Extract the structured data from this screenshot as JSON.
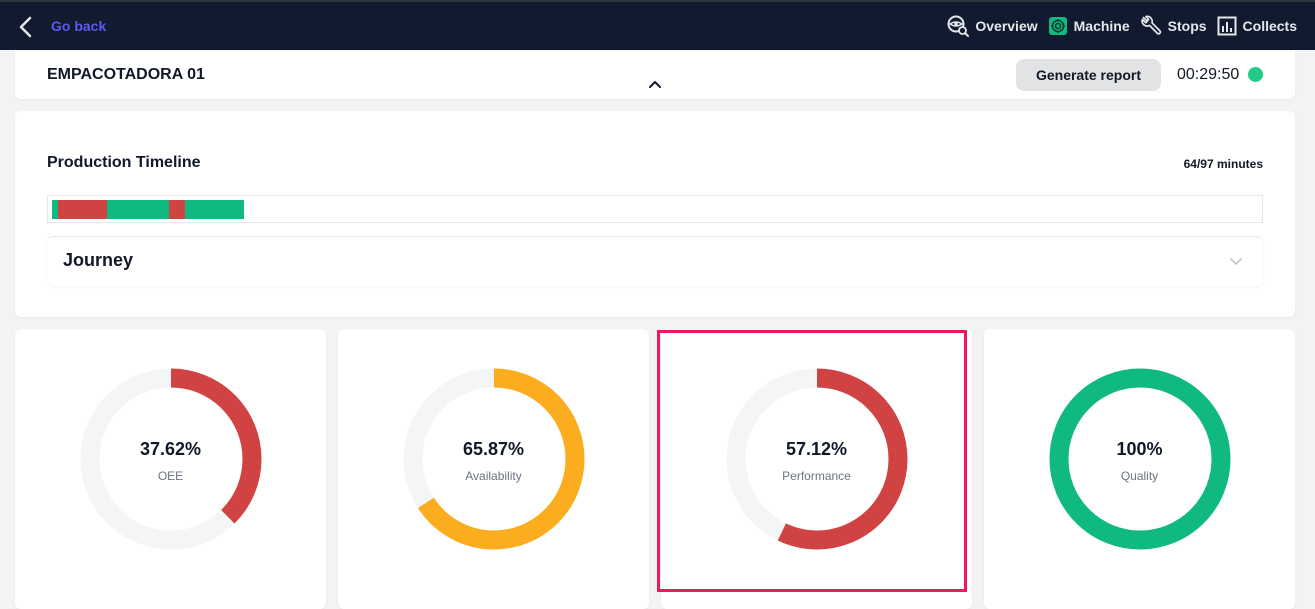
{
  "nav": {
    "back_label": "Go back",
    "items": [
      {
        "label": "Overview",
        "icon": "overview-search-icon"
      },
      {
        "label": "Machine",
        "icon": "machine-icon"
      },
      {
        "label": "Stops",
        "icon": "wrench-icon"
      },
      {
        "label": "Collects",
        "icon": "bar-chart-icon"
      }
    ]
  },
  "header": {
    "machine_name": "EMPACOTADORA 01",
    "report_button": "Generate report",
    "timer": "00:29:50",
    "status_color": "#22cc88"
  },
  "timeline": {
    "title": "Production Timeline",
    "minutes": "64/97 minutes",
    "segments": [
      {
        "status": "running",
        "color": "#10b981",
        "minutes": 0.5
      },
      {
        "status": "stopped",
        "color": "#d14343",
        "minutes": 4
      },
      {
        "status": "running",
        "color": "#10b981",
        "minutes": 5
      },
      {
        "status": "stopped",
        "color": "#d14343",
        "minutes": 1.3
      },
      {
        "status": "running",
        "color": "#10b981",
        "minutes": 4.8
      }
    ],
    "journey_label": "Journey"
  },
  "gauges": [
    {
      "name": "oee",
      "value": "37.62%",
      "label": "OEE",
      "percent": 37.62,
      "color": "#d14343"
    },
    {
      "name": "availability",
      "value": "65.87%",
      "label": "Availability",
      "percent": 65.87,
      "color": "#fbad1f"
    },
    {
      "name": "performance",
      "value": "57.12%",
      "label": "Performance",
      "percent": 57.12,
      "color": "#d14343"
    },
    {
      "name": "quality",
      "value": "100%",
      "label": "Quality",
      "percent": 100,
      "color": "#10b981"
    }
  ],
  "colors": {
    "track": "#f4f5f7",
    "highlight": "#f0185a"
  }
}
